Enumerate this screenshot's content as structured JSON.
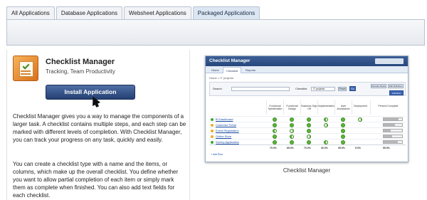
{
  "tabs": [
    {
      "label": "All Applications",
      "active": false
    },
    {
      "label": "Database Applications",
      "active": false
    },
    {
      "label": "Websheet Applications",
      "active": false
    },
    {
      "label": "Packaged Applications",
      "active": true
    }
  ],
  "app": {
    "title": "Checklist Manager",
    "tags": "Tracking, Team Productivity",
    "install_label": "Install Application",
    "description_1": "Checklist Manager gives you a way to manage the components of a larger task. A checklist contains multiple steps, and each step can be marked with different levels of completion. With Checklist Manager, you can track your progress on any task, quickly and easily.",
    "description_2": "You can create a checklist type with a name and the items, or columns, which make up the overall checklist. You define whether you want to allow partial completion of each item or simply mark them as complete when finished. You can also add text fields for each checklist."
  },
  "preview": {
    "caption": "Checklist Manager",
    "app_title": "Checklist Manager",
    "tabs": [
      "Home",
      "Checklist",
      "Reports"
    ],
    "crumb": "Home > IT projects",
    "search_label": "Search",
    "checklist_label": "Checklist",
    "checklist_value": "IT projects",
    "reset_label": "Reset",
    "go_label": "Go",
    "reorder_label": "Reorder Rows",
    "edit_label": "Edit Definition",
    "add_label": "Add Row",
    "columns": [
      "Functional Specification",
      "Functional Design",
      "Business Sign Off",
      "Implementation",
      "User Acceptance",
      "Deployment",
      "Percent Complete"
    ],
    "rows": [
      {
        "name": "BI Dashboard",
        "status": "#3fa535"
      },
      {
        "name": "Customer Portal",
        "status": "#e8b020"
      },
      {
        "name": "Event Registration",
        "status": "#e8b020"
      },
      {
        "name": "Online Store",
        "status": "#e8b020"
      },
      {
        "name": "Survey Application",
        "status": "#3fa535"
      }
    ],
    "totals": [
      "70.0%",
      "65.0%",
      "70.0%",
      "30.0%",
      "95.0%",
      "5.0%",
      "55.0%"
    ],
    "add_row_link": "+ Add Row"
  }
}
